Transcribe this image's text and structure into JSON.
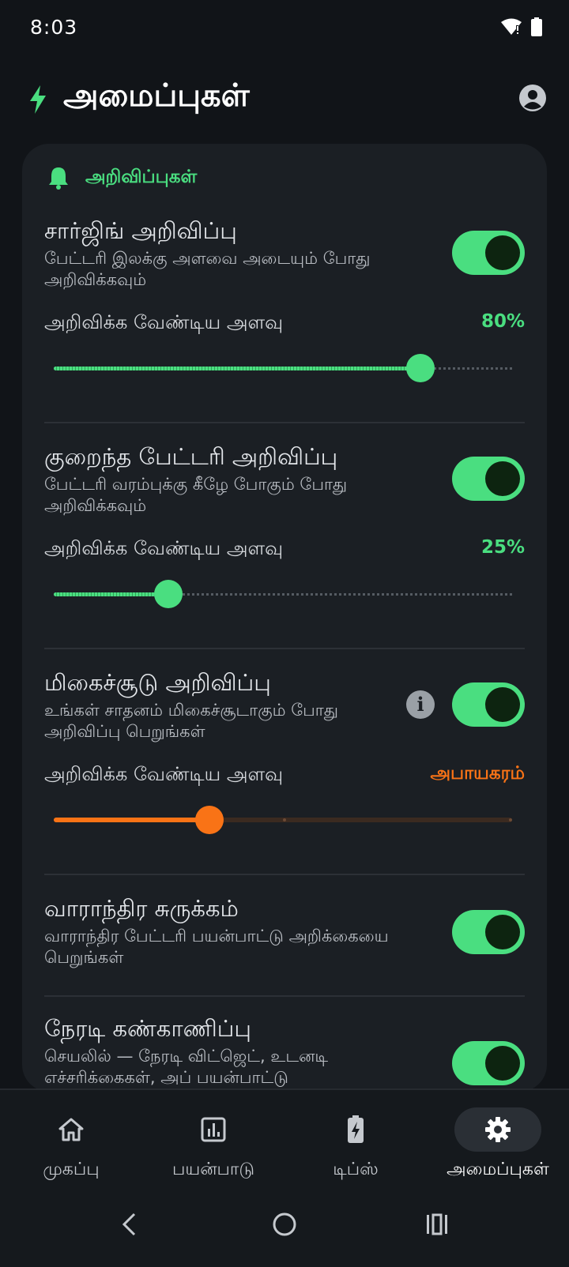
{
  "status": {
    "time": "8:03"
  },
  "appbar": {
    "title": "அமைப்புகள்"
  },
  "section": {
    "label": "அறிவிப்புகள்"
  },
  "settings": [
    {
      "title": "சார்ஜிங் அறிவிப்பு",
      "desc": "பேட்டரி இலக்கு அளவை அடையும் போது அறிவிக்கவும்",
      "enabled": true,
      "threshold_label": "அறிவிக்க வேண்டிய அளவு",
      "threshold_value": "80%",
      "level": 0.8
    },
    {
      "title": "குறைந்த பேட்டரி அறிவிப்பு",
      "desc": "பேட்டரி வரம்புக்கு கீழே போகும் போது அறிவிக்கவும்",
      "enabled": true,
      "threshold_label": "அறிவிக்க வேண்டிய அளவு",
      "threshold_value": "25%",
      "level": 0.25
    },
    {
      "title": "மிகைச்சூடு அறிவிப்பு",
      "desc": "உங்கள் சாதனம் மிகைச்சூடாகும் போது அறிவிப்பு பெறுங்கள்",
      "enabled": true,
      "threshold_label": "அறிவிக்க வேண்டிய அளவு",
      "threshold_value": "அபாயகரம்",
      "level": 0.34
    },
    {
      "title": "வாராந்திர சுருக்கம்",
      "desc": "வாராந்திர பேட்டரி பயன்பாட்டு அறிக்கையை பெறுங்கள்",
      "enabled": true
    },
    {
      "title": "நேரடி கண்காணிப்பு",
      "desc": "செயலில் — நேரடி விட்ஜெட், உடனடி எச்சரிக்கைகள், அப் பயன்பாட்டு",
      "enabled": true
    }
  ],
  "nav": [
    {
      "label": "முகப்பு",
      "icon": "home-icon"
    },
    {
      "label": "பயன்பாடு",
      "icon": "chart-icon"
    },
    {
      "label": "டிப்ஸ்",
      "icon": "battery-charging-icon"
    },
    {
      "label": "அமைப்புகள்",
      "icon": "gear-icon",
      "active": true
    }
  ],
  "colors": {
    "accent": "#4ade80",
    "warning": "#f97316",
    "background": "#111418",
    "card": "#1b1f24"
  }
}
